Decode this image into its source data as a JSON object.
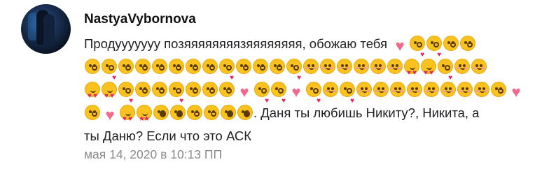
{
  "comment": {
    "author": "NastyaVybornova",
    "lines": [
      {
        "text_before": "Продууууууу позяяяяяяяязяяяяяяяя, обожаю тебя",
        "emoji": [
          "sparkling-heart",
          "kissing-heart",
          "kissing-heart",
          "kissing-closed-eyes",
          "kissing-closed-eyes"
        ],
        "text_after": ""
      },
      {
        "text_before": "",
        "emoji": [
          "kissing-closed-eyes",
          "kissing-heart",
          "kissing-closed-eyes",
          "kissing-closed-eyes",
          "kissing-closed-eyes",
          "kissing-closed-eyes",
          "kissing-closed-eyes",
          "kissing-closed-eyes",
          "kissing-heart",
          "kissing-closed-eyes",
          "kissing-closed-eyes",
          "kissing-closed-eyes",
          "kissing-heart",
          "blush",
          "blush",
          "blush",
          "blush",
          "blush",
          "blush",
          "heart-eyes",
          "heart-eyes",
          "kissing-heart",
          "blush",
          "blush"
        ],
        "text_after": ""
      },
      {
        "text_before": "",
        "emoji": [
          "heart-eyes",
          "heart-eyes",
          "kissing-heart",
          "kissing-closed-eyes",
          "kissing-closed-eyes",
          "kissing-heart",
          "kissing-closed-eyes",
          "kissing-closed-eyes",
          "kissing-closed-eyes",
          "sparkling-heart",
          "kissing-heart",
          "kissing-heart",
          "sparkling-heart",
          "kissing-heart",
          "blush",
          "kissing-heart",
          "blush",
          "blush",
          "blush",
          "blush",
          "blush",
          "blush",
          "blush",
          "blush",
          "kissing-closed-eyes",
          "sparkling-heart"
        ],
        "text_after": ""
      },
      {
        "text_before": "",
        "emoji": [
          "kissing-closed-eyes",
          "sparkling-heart",
          "heart-eyes",
          "star-struck",
          "hushed",
          "hushed",
          "kissing-closed-eyes",
          "kissing-closed-eyes",
          "hushed",
          "hushed"
        ],
        "text_after": ". Даня ты любишь Никиту?, Никита, а"
      },
      {
        "text_before": "ты Даню? Если что это АСК",
        "emoji": [],
        "text_after": ""
      }
    ],
    "timestamp": "мая 14, 2020 в 10:13 ПП"
  },
  "colors": {
    "emoji_face": "#f9c21f",
    "heart": "#f06b8b",
    "timestamp": "#8a8a8a",
    "author": "#111111"
  }
}
